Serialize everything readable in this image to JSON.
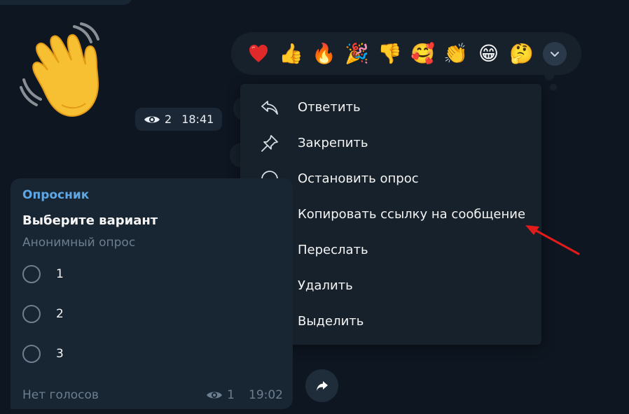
{
  "sticker": {
    "emoji": "👋",
    "views": "2",
    "time": "18:41"
  },
  "reactions": [
    {
      "name": "heart",
      "glyph": "❤️"
    },
    {
      "name": "thumbs-up",
      "glyph": "👍"
    },
    {
      "name": "fire",
      "glyph": "🔥"
    },
    {
      "name": "party-popper",
      "glyph": "🎉"
    },
    {
      "name": "thumbs-down",
      "glyph": "👎"
    },
    {
      "name": "smiling-face-with-hearts",
      "glyph": "🥰"
    },
    {
      "name": "clapping-hands",
      "glyph": "👏"
    },
    {
      "name": "grinning-face",
      "glyph": "😁"
    },
    {
      "name": "thinking-face",
      "glyph": "🤔"
    }
  ],
  "menu": {
    "items": [
      {
        "label": "Ответить",
        "icon": "reply-icon"
      },
      {
        "label": "Закрепить",
        "icon": "pin-icon"
      },
      {
        "label": "Остановить опрос",
        "icon": "stop-poll-icon"
      },
      {
        "label": "Копировать ссылку на сообщение",
        "icon": "link-icon"
      },
      {
        "label": "Переслать",
        "icon": "forward-icon"
      },
      {
        "label": "Удалить",
        "icon": "trash-icon"
      },
      {
        "label": "Выделить",
        "icon": "select-icon"
      }
    ]
  },
  "poll": {
    "sender": "Опросник",
    "question": "Выберите вариант",
    "type": "Анонимный опрос",
    "options": [
      "1",
      "2",
      "3"
    ],
    "votes_text": "Нет голосов",
    "views": "1",
    "time": "19:02"
  },
  "colors": {
    "background": "#0e1621",
    "bubble": "#182533",
    "menu": "#17212b",
    "accent": "#5fa7e4",
    "annotation": "#e31b1b"
  }
}
